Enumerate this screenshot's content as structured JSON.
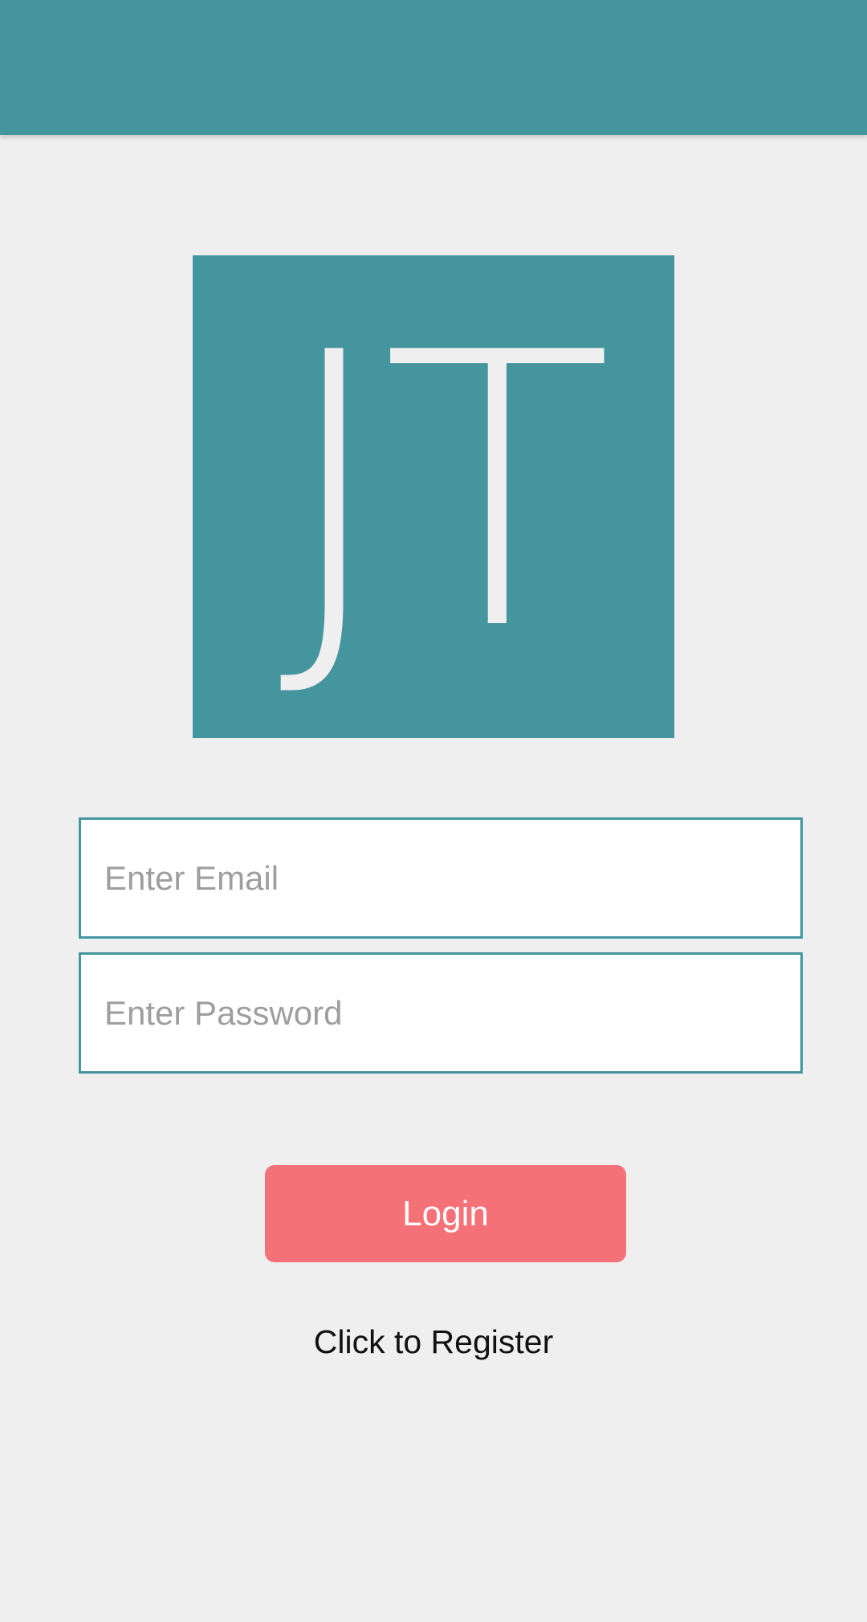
{
  "colors": {
    "primary": "#45959f",
    "accent": "#f47177",
    "background": "#efefef"
  },
  "logo": {
    "text": "JT"
  },
  "form": {
    "email_placeholder": "Enter Email",
    "password_placeholder": "Enter Password",
    "login_label": "Login",
    "register_label": "Click to Register"
  }
}
